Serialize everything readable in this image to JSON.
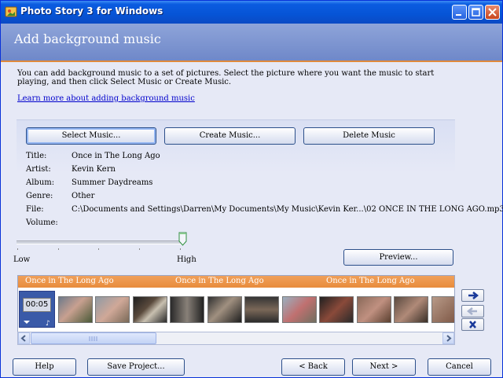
{
  "window": {
    "title": "Photo Story 3 for Windows"
  },
  "header": {
    "heading": "Add background music"
  },
  "intro": {
    "text": "You can add background music to a set of pictures.  Select the picture where you want the music to start playing, and then click Select Music or Create Music."
  },
  "learn_link": "Learn more about adding background music",
  "buttons": {
    "select_music": "Select Music...",
    "create_music": "Create Music...",
    "delete_music": "Delete Music",
    "preview": "Preview..."
  },
  "fields": {
    "title_label": "Title:",
    "title_value": "Once in The Long Ago",
    "artist_label": "Artist:",
    "artist_value": "Kevin Kern",
    "album_label": "Album:",
    "album_value": "Summer Daydreams",
    "genre_label": "Genre:",
    "genre_value": "Other",
    "file_label": "File:",
    "file_value": "C:\\Documents and Settings\\Darren\\My Documents\\My Music\\Kevin Ker...\\02 ONCE IN THE LONG AGO.mp3"
  },
  "volume": {
    "label": "Volume:",
    "low": "Low",
    "high": "High",
    "level": 1.0
  },
  "timeline": {
    "music_segments": [
      "Once in The Long Ago",
      "Once in The Long Ago",
      "Once in The Long Ago"
    ],
    "selected_time": "00:05",
    "thumbnail_count": 12
  },
  "footer": {
    "help": "Help",
    "save_project": "Save Project...",
    "back": "< Back",
    "next": "Next >",
    "cancel": "Cancel"
  },
  "colors": {
    "accent": "#e88c3c",
    "titlebar": "#0654d6",
    "header": "#7b93cf"
  }
}
